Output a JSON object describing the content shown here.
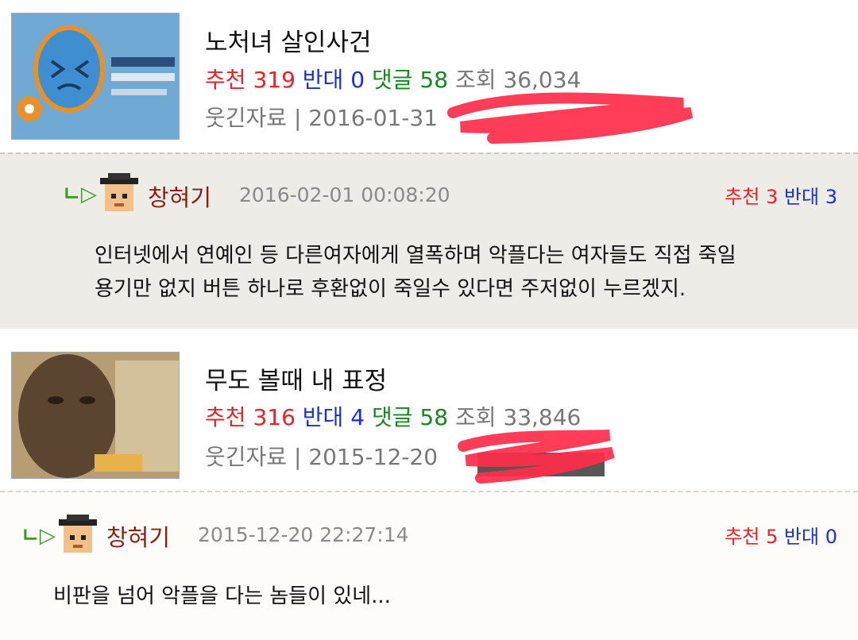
{
  "posts": [
    {
      "title": "노처녀 살인사건",
      "recommend_label": "추천",
      "recommend": "319",
      "oppose_label": "반대",
      "oppose": "0",
      "comments_label": "댓글",
      "comments": "58",
      "views_label": "조회",
      "views": "36,034",
      "category": "웃긴자료",
      "separator": "|",
      "date": "2016-01-31"
    },
    {
      "title": "무도 볼때 내 표정",
      "recommend_label": "추천",
      "recommend": "316",
      "oppose_label": "반대",
      "oppose": "4",
      "comments_label": "댓글",
      "comments": "58",
      "views_label": "조회",
      "views": "33,846",
      "category": "웃긴자료",
      "separator": "|",
      "date": "2015-12-20"
    }
  ],
  "replies": [
    {
      "reply_icon": "ㄴ▷",
      "author": "창혀기",
      "datetime": "2016-02-01 00:08:20",
      "recommend_label": "추천",
      "recommend": "3",
      "oppose_label": "반대",
      "oppose": "3",
      "text_line1": "인터넷에서 연예인 등 다른여자에게 열폭하며 악플다는 여자들도 직접 죽일",
      "text_line2": "용기만 없지 버튼 하나로 후환없이 죽일수 있다면 주저없이 누르겠지."
    },
    {
      "reply_icon": "ㄴ▷",
      "author": "창혀기",
      "datetime": "2015-12-20 22:27:14",
      "recommend_label": "추천",
      "recommend": "5",
      "oppose_label": "반대",
      "oppose": "0",
      "text_line1": "비판을 넘어 악플을 다는 놈들이 있네..."
    }
  ],
  "colors": {
    "recommend": "#e8212a",
    "oppose": "#1b2fd6",
    "comments": "#138a1b",
    "author": "#8a1e14",
    "scribble": "#ff2d4a"
  }
}
